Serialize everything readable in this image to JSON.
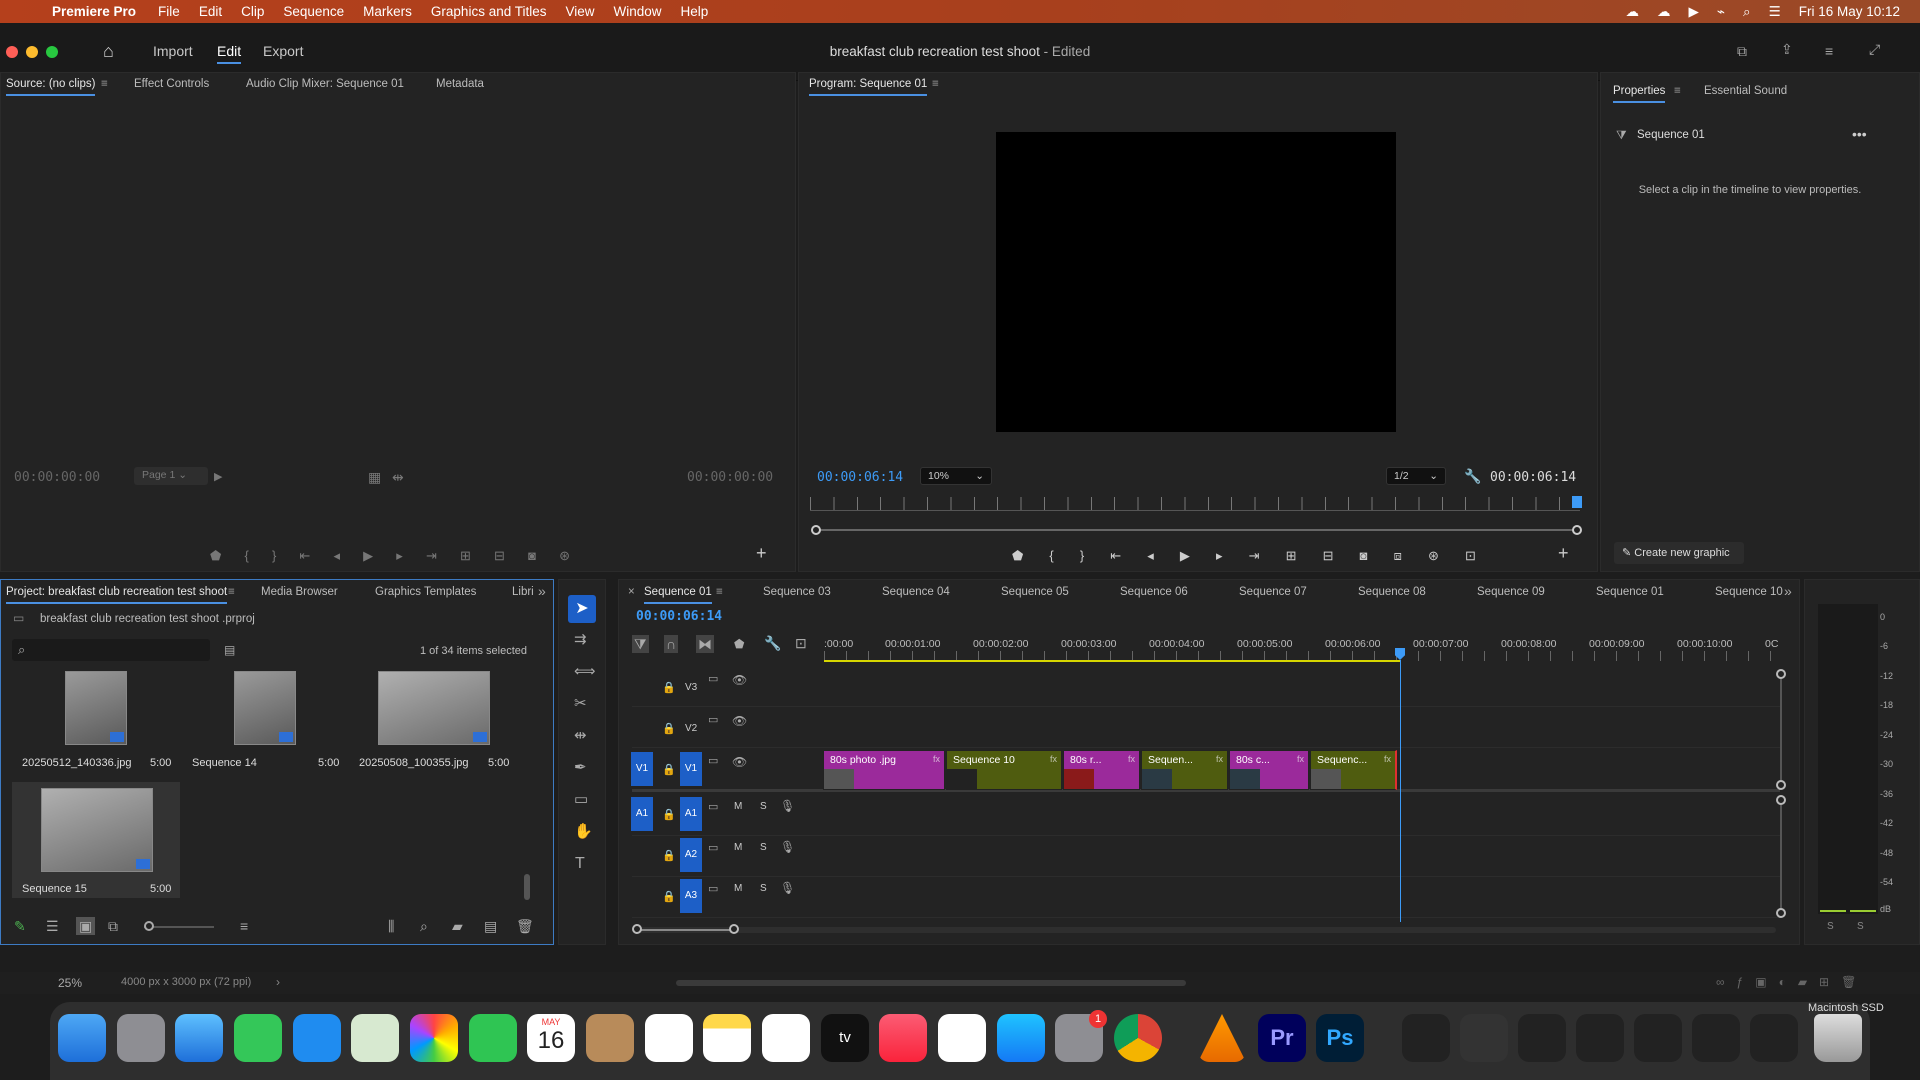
{
  "menubar": {
    "app": "Premiere Pro",
    "items": [
      "File",
      "Edit",
      "Clip",
      "Sequence",
      "Markers",
      "Graphics and Titles",
      "View",
      "Window",
      "Help"
    ],
    "clock": "Fri 16 May  10:12"
  },
  "header": {
    "nav": [
      "Import",
      "Edit",
      "Export"
    ],
    "title": "breakfast club recreation test shoot",
    "title_suffix": "- Edited"
  },
  "source": {
    "tabs": [
      "Source: (no clips)",
      "Effect Controls",
      "Audio Clip Mixer: Sequence 01",
      "Metadata"
    ],
    "tc_left": "00:00:00:00",
    "page": "Page 1",
    "tc_right": "00:00:00:00"
  },
  "program": {
    "tab": "Program: Sequence 01",
    "tc_left": "00:00:06:14",
    "zoom": "10%",
    "quality": "1/2",
    "tc_right": "00:00:06:14"
  },
  "properties": {
    "tabs": [
      "Properties",
      "Essential Sound"
    ],
    "sequence": "Sequence 01",
    "hint": "Select a clip in the timeline to view properties.",
    "create_btn": "Create new graphic"
  },
  "project": {
    "tabs": [
      "Project: breakfast club recreation test shoot",
      "Media Browser",
      "Graphics Templates",
      "Libri"
    ],
    "file": "breakfast club recreation test shoot .prproj",
    "selected": "1 of 34 items selected",
    "items": [
      {
        "name": "20250512_140336.jpg",
        "dur": "5:00"
      },
      {
        "name": "Sequence 14",
        "dur": "5:00"
      },
      {
        "name": "20250508_100355.jpg",
        "dur": "5:00"
      },
      {
        "name": "Sequence 15",
        "dur": "5:00"
      }
    ]
  },
  "timeline": {
    "tabs": [
      "Sequence 01",
      "Sequence 03",
      "Sequence 04",
      "Sequence 05",
      "Sequence 06",
      "Sequence 07",
      "Sequence 08",
      "Sequence 09",
      "Sequence 01",
      "Sequence 10"
    ],
    "tc": "00:00:06:14",
    "ruler": [
      ":00:00",
      "00:00:01:00",
      "00:00:02:00",
      "00:00:03:00",
      "00:00:04:00",
      "00:00:05:00",
      "00:00:06:00",
      "00:00:07:00",
      "00:00:08:00",
      "00:00:09:00",
      "00:00:10:00",
      "0C"
    ],
    "tracks": {
      "video": [
        "V3",
        "V2",
        "V1"
      ],
      "audio": [
        "A1",
        "A2",
        "A3"
      ],
      "src_v": "V1",
      "src_a": "A1",
      "m": "M",
      "s": "S"
    },
    "clips": [
      {
        "name": "80s photo .jpg",
        "fx": "fx",
        "color": "#9b2a9b"
      },
      {
        "name": "Sequence 10",
        "fx": "fx",
        "color": "#4f5c0f"
      },
      {
        "name": "80s r...",
        "fx": "fx",
        "color": "#9b2a9b"
      },
      {
        "name": "Sequen...",
        "fx": "fx",
        "color": "#4f5c0f"
      },
      {
        "name": "80s c...",
        "fx": "fx",
        "color": "#9b2a9b"
      },
      {
        "name": "Sequenc...",
        "fx": "fx",
        "color": "#4f5c0f"
      }
    ]
  },
  "meter": {
    "labels": [
      "0",
      "-6",
      "-12",
      "-18",
      "-24",
      "-30",
      "-36",
      "-42",
      "-48",
      "-54",
      "dB"
    ],
    "solo": [
      "S",
      "S"
    ]
  },
  "status": {
    "zoom": "25%",
    "info": "4000 px x 3000 px (72 ppi)"
  },
  "dock": {
    "calendar_month": "MAY",
    "calendar_day": "16",
    "tv": "tv",
    "badge": "1",
    "drive": "Macintosh SSD"
  }
}
